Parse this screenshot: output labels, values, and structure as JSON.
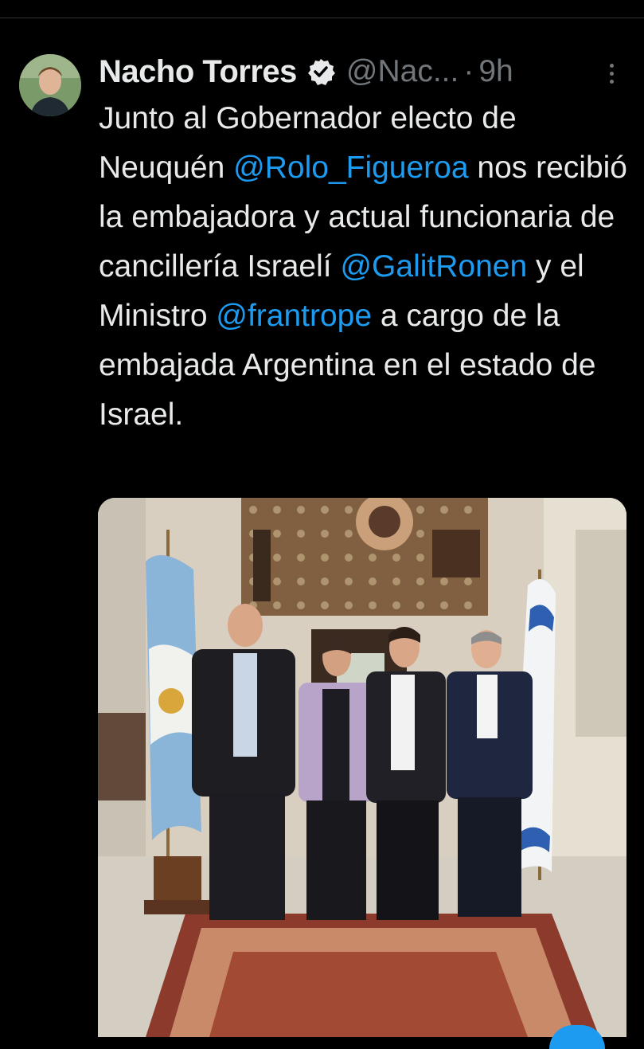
{
  "tweet": {
    "author_name": "Nacho Torres",
    "handle": "@Nac...",
    "separator": "·",
    "time": "9h",
    "text_parts": [
      "Junto al Gobernador electo de Neuquén ",
      "@Rolo_Figueroa",
      " nos recibió la embajadora y actual funcionaria de cancillería Israelí ",
      "@GalitRonen",
      " y el Ministro ",
      "@frantrope",
      " a cargo de la embajada Argentina en el estado de Israel."
    ]
  },
  "colors": {
    "background": "#000000",
    "text": "#e7e9ea",
    "secondary": "#71767b",
    "accent": "#1d9bf0"
  },
  "icons": {
    "verified": "verified-badge-icon",
    "more": "more-options-icon"
  }
}
